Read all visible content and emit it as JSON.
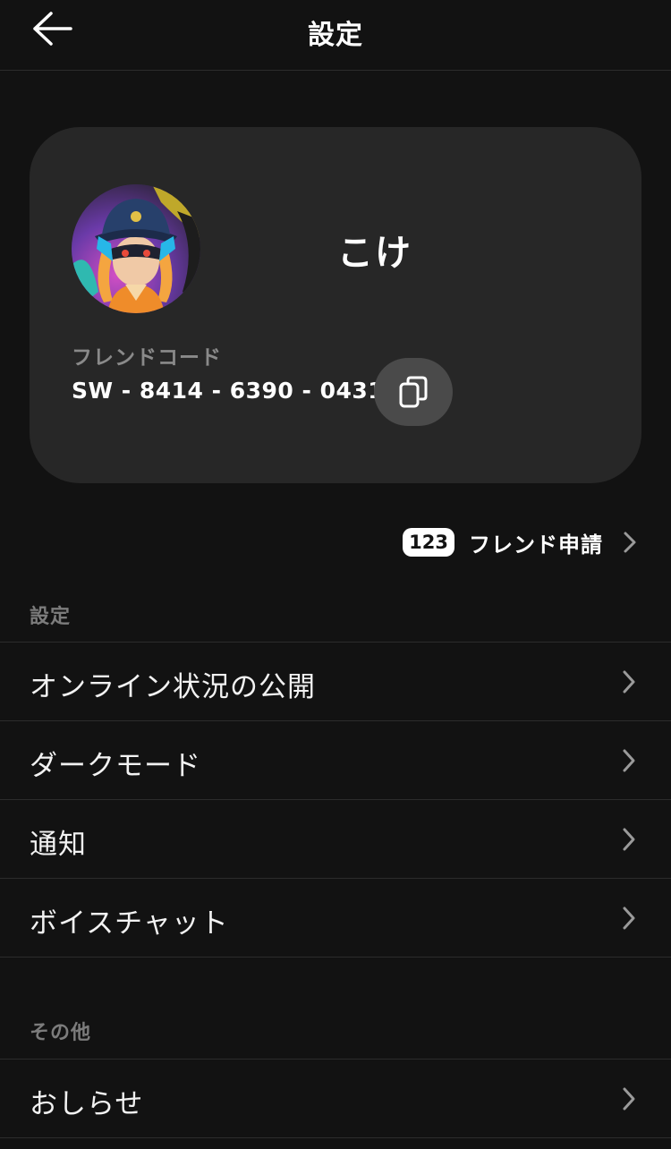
{
  "header": {
    "title": "設定",
    "back_icon": "arrow-left-icon"
  },
  "profile": {
    "username": "こけ",
    "friend_code_label": "フレンドコード",
    "friend_code": "SW - 8414 - 6390 - 0431",
    "copy_icon": "copy-icon"
  },
  "friend_requests": {
    "count": "123",
    "label": "フレンド申請"
  },
  "sections": {
    "settings_label": "設定",
    "settings_items": [
      {
        "label": "オンライン状況の公開"
      },
      {
        "label": "ダークモード"
      },
      {
        "label": "通知"
      },
      {
        "label": "ボイスチャット"
      }
    ],
    "other_label": "その他",
    "other_items": [
      {
        "label": "おしらせ"
      }
    ]
  },
  "colors": {
    "background": "#121212",
    "card": "#272727",
    "divider": "#2c2c2c",
    "muted_text": "#8a8a8a",
    "copy_button": "#4a4a4a"
  }
}
